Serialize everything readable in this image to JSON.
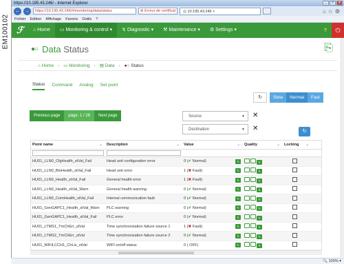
{
  "doc_id": "EM100102",
  "browser": {
    "title": "https://10.195.43.246/ - Internet Explorer",
    "url": "https://10.195.43.246/#/monitoring/data/status",
    "cert_error": "Erreur de certificat",
    "tab_label": "10.195.43.246",
    "menu": [
      "Fichier",
      "Edition",
      "Affichage",
      "Favoris",
      "Outils",
      "?"
    ],
    "zoom": "100%"
  },
  "appnav": {
    "items": [
      "Home",
      "Monitoring & control",
      "Diagnostic",
      "Maintenance",
      "Settings"
    ],
    "active": "Monitoring & control",
    "user_icon": "?"
  },
  "page": {
    "title_main": "Data",
    "title_sub": "Status"
  },
  "breadcrumb": [
    "Home",
    "Monitoring",
    "Data",
    "Status"
  ],
  "tabs": [
    "Status",
    "Command",
    "Analog",
    "Set point"
  ],
  "speed": [
    "Slow",
    "Normal",
    "Fast"
  ],
  "speed_selected": "Normal",
  "pager": {
    "prev": "Previous page",
    "current": "page: 1 / 26",
    "next": "Next page"
  },
  "filters": {
    "source": "Source",
    "destination": "Destination"
  },
  "columns": [
    "Point name",
    "Description",
    "Value",
    "Quality",
    "Locking"
  ],
  "rows": [
    {
      "name": "HU01_LLN0_CfgHealth_stVal_Fail",
      "desc": "Head unit configuration error",
      "val": "0",
      "state": "Normal",
      "ok": true
    },
    {
      "name": "HU01_LLN0_BinHealth_stVal_Fail",
      "desc": "Head unit error",
      "val": "1",
      "state": "Fault",
      "ok": false
    },
    {
      "name": "HU01_LLN0_Health_stVal_Fail",
      "desc": "General health error",
      "val": "1",
      "state": "Fault",
      "ok": false
    },
    {
      "name": "HU01_LLN0_Health_stVal_Warn",
      "desc": "General health warning",
      "val": "0",
      "state": "Normal",
      "ok": true
    },
    {
      "name": "HU01_LLN0_ComHealth_stVal_Fail",
      "desc": "Internal communication fault",
      "val": "0",
      "state": "Normal",
      "ok": true
    },
    {
      "name": "HU01_GenGAPC1_Health_stVal_Warn",
      "desc": "PLC warning",
      "val": "0",
      "state": "Normal",
      "ok": true
    },
    {
      "name": "HU01_GenGAPC1_Health_stVal_Fail",
      "desc": "PLC error",
      "val": "0",
      "state": "Normal",
      "ok": true
    },
    {
      "name": "HU01_LTMS1_TmChErr_stVal",
      "desc": "Time synchronization failure source 1",
      "val": "1",
      "state": "Fault",
      "ok": false
    },
    {
      "name": "HU01_LTMS2_TmChErr_stVal",
      "desc": "Time synchronization failure source 2",
      "val": "0",
      "state": "Normal",
      "ok": true
    },
    {
      "name": "HU01_WIFiLCCH1_ChLiv_stVal",
      "desc": "WIFI on/off status",
      "val": "0",
      "state": "OFF",
      "ok": null
    }
  ]
}
